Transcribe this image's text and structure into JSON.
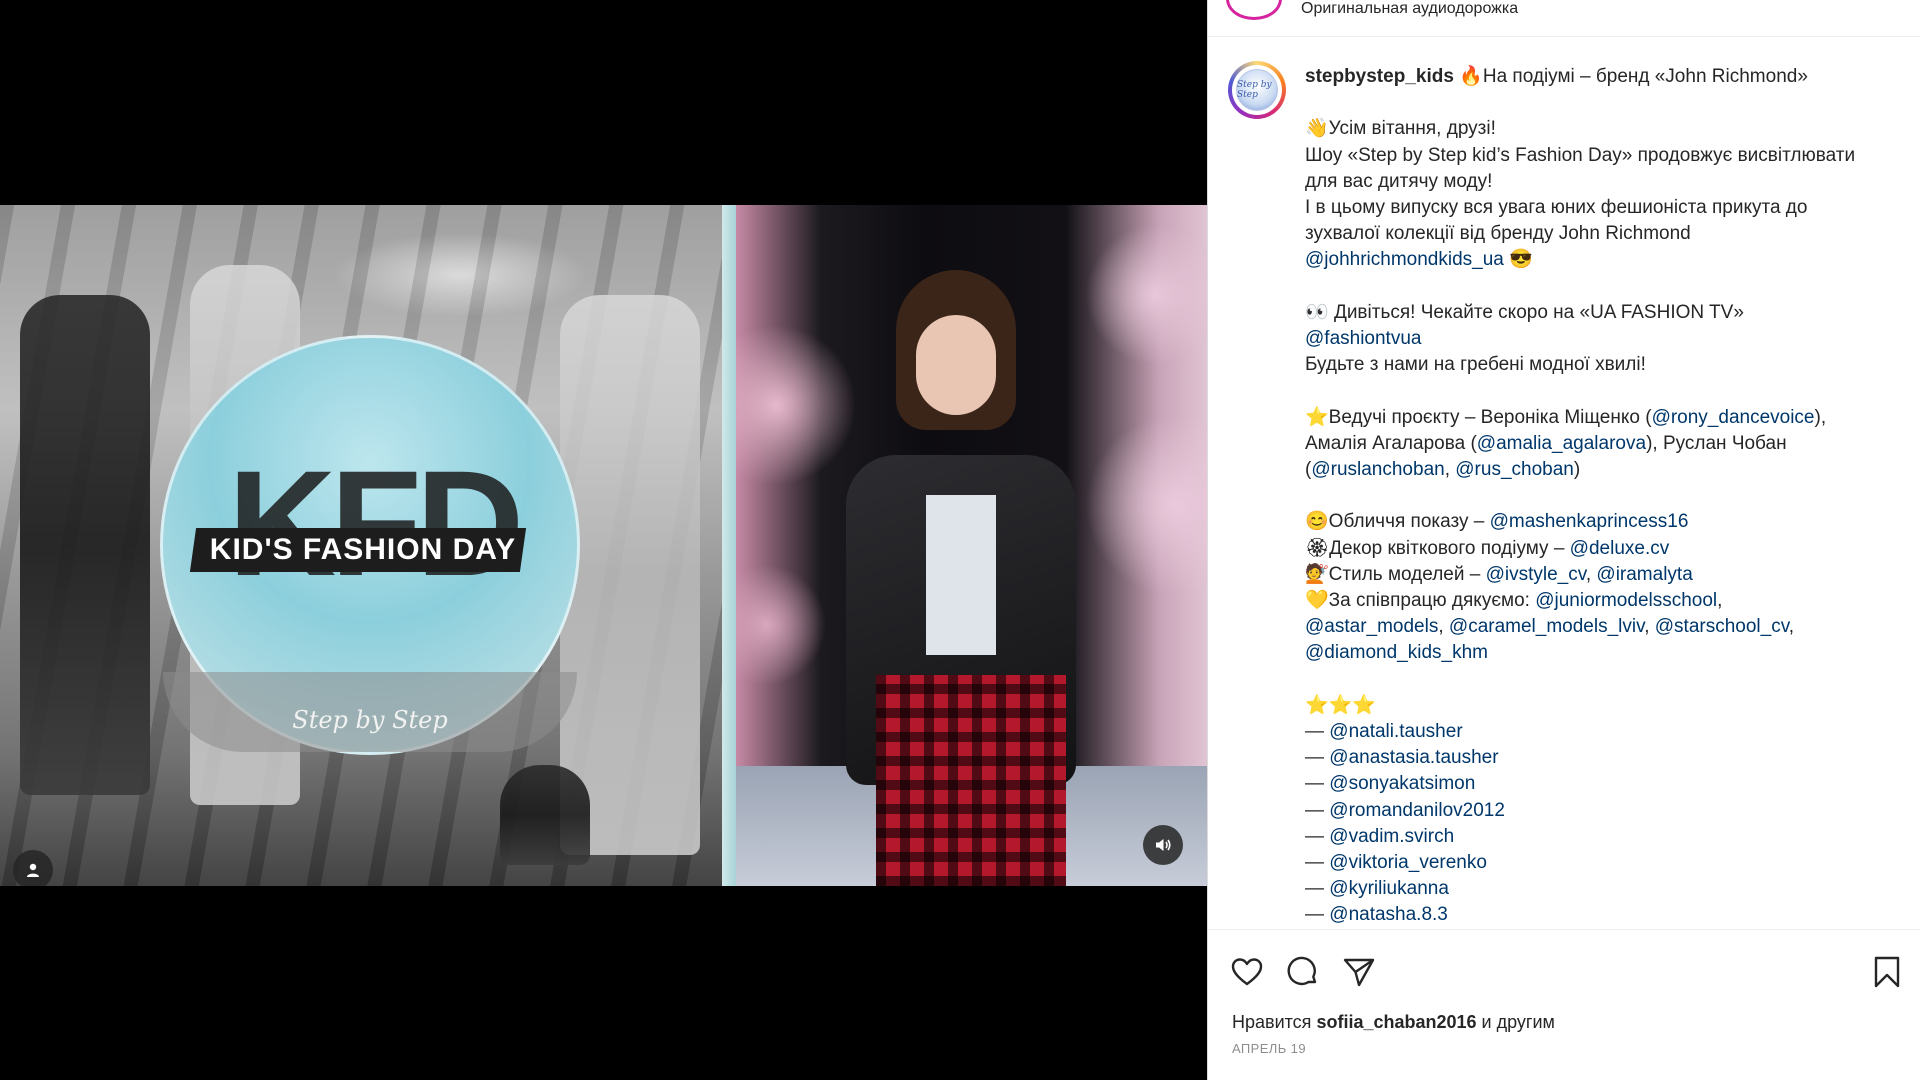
{
  "header": {
    "audio_label": "Оригинальная аудиодорожка"
  },
  "video": {
    "logo_title": "KID'S FASHION DAY",
    "logo_letters": "KFD",
    "logo_subtitle": "Step by Step"
  },
  "post": {
    "username": "stepbystep_kids",
    "avatar_text": "Step by Step",
    "lines": [
      {
        "parts": [
          {
            "t": "🔥",
            "type": "emoji"
          },
          {
            "t": "На подіумі – бренд «John Richmond»",
            "type": "text"
          }
        ]
      },
      {
        "gap": true
      },
      {
        "parts": [
          {
            "t": "👋",
            "type": "emoji"
          },
          {
            "t": "Усім вітання, друзі!",
            "type": "text"
          }
        ]
      },
      {
        "parts": [
          {
            "t": "Шоу «Step by Step kid’s Fashion Day» продовжує висвітлювати",
            "type": "text"
          }
        ]
      },
      {
        "parts": [
          {
            "t": "для вас дитячу моду!",
            "type": "text"
          }
        ]
      },
      {
        "parts": [
          {
            "t": "І в цьому випуску вся увага юних фешионіста прикута до",
            "type": "text"
          }
        ]
      },
      {
        "parts": [
          {
            "t": "зухвалої колекції від бренду John Richmond",
            "type": "text"
          }
        ]
      },
      {
        "parts": [
          {
            "t": "@johhrichmondkids_ua",
            "type": "mention"
          },
          {
            "t": " ",
            "type": "text"
          },
          {
            "t": "😎",
            "type": "emoji"
          }
        ]
      },
      {
        "gap": true
      },
      {
        "parts": [
          {
            "t": "👀",
            "type": "emoji"
          },
          {
            "t": " Дивіться! Чекайте скоро на «UA FASHION TV»",
            "type": "text"
          }
        ]
      },
      {
        "parts": [
          {
            "t": "@fashiontvua",
            "type": "mention"
          }
        ]
      },
      {
        "parts": [
          {
            "t": "Будьте з нами на гребені модної хвилі!",
            "type": "text"
          }
        ]
      },
      {
        "gap": true
      },
      {
        "parts": [
          {
            "t": "⭐",
            "type": "emoji"
          },
          {
            "t": "Ведучі проєкту – Вероніка Міщенко (",
            "type": "text"
          },
          {
            "t": "@rony_dancevoice",
            "type": "mention"
          },
          {
            "t": "),",
            "type": "text"
          }
        ]
      },
      {
        "parts": [
          {
            "t": "Амалія Агаларова (",
            "type": "text"
          },
          {
            "t": "@amalia_agalarova",
            "type": "mention"
          },
          {
            "t": "), Руслан Чобан",
            "type": "text"
          }
        ]
      },
      {
        "parts": [
          {
            "t": "(",
            "type": "text"
          },
          {
            "t": "@ruslanchoban",
            "type": "mention"
          },
          {
            "t": ", ",
            "type": "text"
          },
          {
            "t": "@rus_choban",
            "type": "mention"
          },
          {
            "t": ")",
            "type": "text"
          }
        ]
      },
      {
        "gap": true
      },
      {
        "parts": [
          {
            "t": "😊",
            "type": "emoji"
          },
          {
            "t": "Обличчя показу – ",
            "type": "text"
          },
          {
            "t": "@mashenkaprincess16",
            "type": "mention"
          }
        ]
      },
      {
        "parts": [
          {
            "t": "🏵",
            "type": "emoji"
          },
          {
            "t": "Декор квіткового подіуму – ",
            "type": "text"
          },
          {
            "t": "@deluxe.cv",
            "type": "mention"
          }
        ]
      },
      {
        "parts": [
          {
            "t": "💇",
            "type": "emoji"
          },
          {
            "t": "Стиль моделей – ",
            "type": "text"
          },
          {
            "t": "@ivstyle_cv",
            "type": "mention"
          },
          {
            "t": ", ",
            "type": "text"
          },
          {
            "t": "@iramalyta",
            "type": "mention"
          }
        ]
      },
      {
        "parts": [
          {
            "t": "💛",
            "type": "emoji"
          },
          {
            "t": "За співпрацю дякуємо: ",
            "type": "text"
          },
          {
            "t": "@juniormodelsschool",
            "type": "mention"
          },
          {
            "t": ",",
            "type": "text"
          }
        ]
      },
      {
        "parts": [
          {
            "t": "@astar_models",
            "type": "mention"
          },
          {
            "t": ", ",
            "type": "text"
          },
          {
            "t": "@caramel_models_lviv",
            "type": "mention"
          },
          {
            "t": ", ",
            "type": "text"
          },
          {
            "t": "@starschool_cv",
            "type": "mention"
          },
          {
            "t": ",",
            "type": "text"
          }
        ]
      },
      {
        "parts": [
          {
            "t": "@diamond_kids_khm",
            "type": "mention"
          }
        ]
      },
      {
        "gap": true
      },
      {
        "parts": [
          {
            "t": "⭐⭐⭐",
            "type": "emoji"
          }
        ]
      },
      {
        "parts": [
          {
            "t": "— ",
            "type": "text"
          },
          {
            "t": "@natali.tausher",
            "type": "mention"
          }
        ]
      },
      {
        "parts": [
          {
            "t": "— ",
            "type": "text"
          },
          {
            "t": "@anastasia.tausher",
            "type": "mention"
          }
        ]
      },
      {
        "parts": [
          {
            "t": "— ",
            "type": "text"
          },
          {
            "t": "@sonyakatsimon",
            "type": "mention"
          }
        ]
      },
      {
        "parts": [
          {
            "t": "— ",
            "type": "text"
          },
          {
            "t": "@romandanilov2012",
            "type": "mention"
          }
        ]
      },
      {
        "parts": [
          {
            "t": "— ",
            "type": "text"
          },
          {
            "t": "@vadim.svirch",
            "type": "mention"
          }
        ]
      },
      {
        "parts": [
          {
            "t": "— ",
            "type": "text"
          },
          {
            "t": "@viktoria_verenko",
            "type": "mention"
          }
        ]
      },
      {
        "parts": [
          {
            "t": "— ",
            "type": "text"
          },
          {
            "t": "@kyriliukanna",
            "type": "mention"
          }
        ]
      },
      {
        "parts": [
          {
            "t": "— ",
            "type": "text"
          },
          {
            "t": "@natasha.8.3",
            "type": "mention"
          }
        ]
      }
    ]
  },
  "footer": {
    "likes_prefix": "Нравится ",
    "likes_user": "sofiia_chaban2016",
    "likes_suffix": " и другим",
    "date": "АПРЕЛЬ 19"
  },
  "icons": {
    "user_tag": "user-tag-icon",
    "sound": "sound-icon",
    "like": "heart-icon",
    "comment": "comment-icon",
    "share": "paper-plane-icon",
    "save": "bookmark-icon"
  },
  "colors": {
    "mention": "#00376b",
    "text": "#262626",
    "muted": "#8e8e8e"
  }
}
